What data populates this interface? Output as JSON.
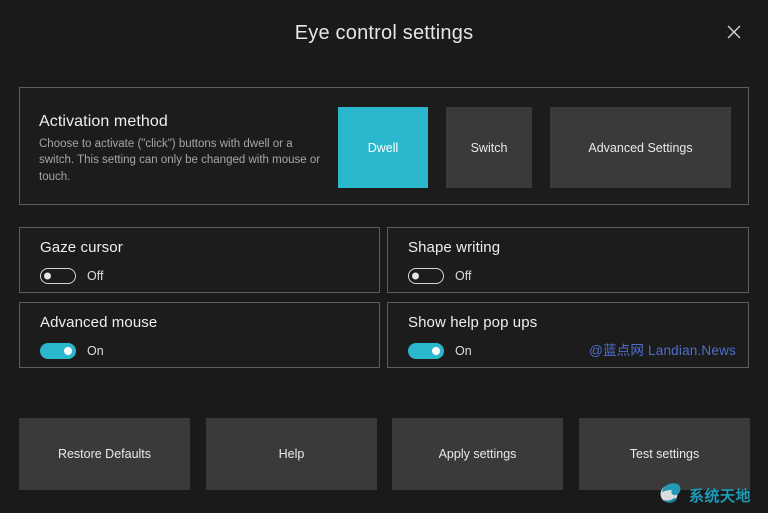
{
  "window": {
    "title": "Eye control settings",
    "close_icon": "close-icon",
    "background_color": "#1a1a1a",
    "accent_color": "#2bb8cf"
  },
  "activation": {
    "title": "Activation method",
    "description": "Choose to activate (\"click\") buttons with dwell or a switch. This setting can only be changed with mouse or touch.",
    "options": [
      {
        "label": "Dwell",
        "selected": true
      },
      {
        "label": "Switch",
        "selected": false
      },
      {
        "label": "Advanced Settings",
        "selected": false
      }
    ]
  },
  "cards": [
    {
      "title": "Gaze cursor",
      "state": "Off",
      "on": false
    },
    {
      "title": "Shape writing",
      "state": "Off",
      "on": false
    },
    {
      "title": "Advanced mouse",
      "state": "On",
      "on": true
    },
    {
      "title": "Show help pop ups",
      "state": "On",
      "on": true
    }
  ],
  "bottom_buttons": [
    {
      "label": "Restore Defaults"
    },
    {
      "label": "Help"
    },
    {
      "label": "Apply settings"
    },
    {
      "label": "Test settings"
    }
  ],
  "watermarks": {
    "landian": "@蓝点网 Landian.News",
    "landian_color": "#4c6fd0",
    "logo_text": "系统天地",
    "logo_color": "#1d9bb8",
    "logo_icon": "swirl-logo-icon"
  }
}
